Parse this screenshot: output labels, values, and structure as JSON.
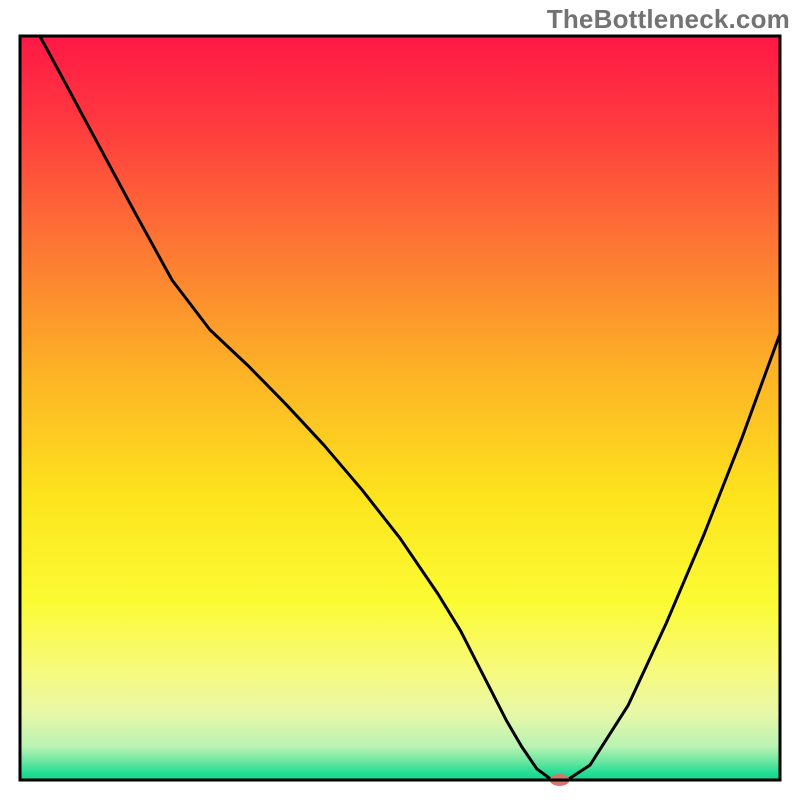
{
  "watermark": "TheBottleneck.com",
  "chart_data": {
    "type": "line",
    "title": "",
    "xlabel": "",
    "ylabel": "",
    "xlim": [
      0,
      100
    ],
    "ylim": [
      0,
      100
    ],
    "grid": false,
    "legend": false,
    "background": {
      "type": "vertical-gradient",
      "stops": [
        {
          "offset": 0.0,
          "color": "#ff1846"
        },
        {
          "offset": 0.12,
          "color": "#ff3b3f"
        },
        {
          "offset": 0.28,
          "color": "#fd7634"
        },
        {
          "offset": 0.45,
          "color": "#fdb226"
        },
        {
          "offset": 0.62,
          "color": "#fde41d"
        },
        {
          "offset": 0.76,
          "color": "#fbfb33"
        },
        {
          "offset": 0.85,
          "color": "#f7fa7a"
        },
        {
          "offset": 0.91,
          "color": "#e8f8a8"
        },
        {
          "offset": 0.955,
          "color": "#b9f2b3"
        },
        {
          "offset": 0.975,
          "color": "#6be7a1"
        },
        {
          "offset": 0.99,
          "color": "#25dd95"
        },
        {
          "offset": 1.0,
          "color": "#17d48d"
        }
      ]
    },
    "series": [
      {
        "name": "bottleneck-curve",
        "color": "#000000",
        "x": [
          2.6,
          5,
          10,
          15,
          20,
          25,
          30,
          35,
          40,
          45,
          50,
          55,
          58,
          60,
          62,
          64,
          66,
          68,
          70,
          72,
          75,
          80,
          85,
          90,
          95,
          100
        ],
        "y": [
          100,
          95.5,
          86,
          76.5,
          67.2,
          60.5,
          55.7,
          50.5,
          45,
          39,
          32.5,
          25,
          20,
          16,
          12,
          8,
          4.5,
          1.5,
          0,
          0,
          2,
          10,
          21,
          33,
          46,
          60
        ]
      }
    ],
    "marker": {
      "name": "optimal-point",
      "x": 71,
      "y": 0,
      "rx": 1.3,
      "ry": 0.8,
      "color": "#d9746e"
    },
    "frame": {
      "color": "#000000",
      "width": 3
    }
  }
}
